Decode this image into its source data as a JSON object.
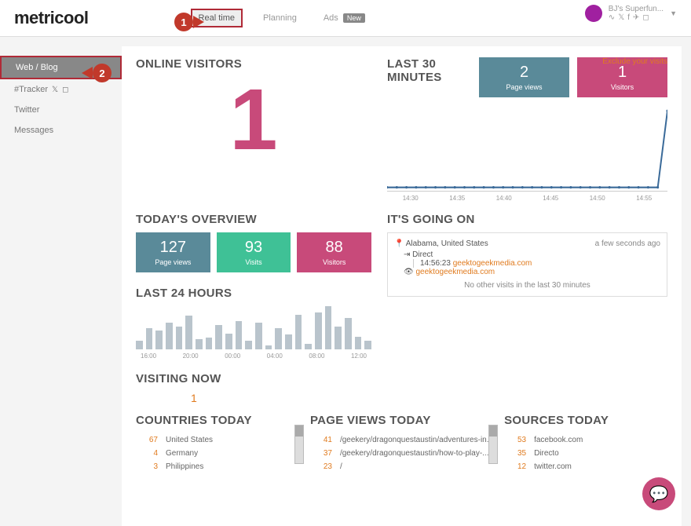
{
  "brand": "metricool",
  "nav": {
    "realtime": "Real time",
    "planning": "Planning",
    "ads": "Ads",
    "ads_badge": "New"
  },
  "user": {
    "name": "BJ's Superfun..."
  },
  "sidebar": {
    "items": [
      {
        "label": "Web / Blog"
      },
      {
        "label": "#Tracker"
      },
      {
        "label": "Twitter"
      },
      {
        "label": "Messages"
      }
    ]
  },
  "exclude_link": "Exclude your visits",
  "online_visitors": {
    "title": "ONLINE VISITORS",
    "value": "1"
  },
  "last30": {
    "title": "LAST 30 MINUTES",
    "pageviews": {
      "value": "2",
      "label": "Page views"
    },
    "visitors": {
      "value": "1",
      "label": "Visitors"
    },
    "x_ticks": [
      "14:30",
      "14:35",
      "14:40",
      "14:45",
      "14:50",
      "14:55"
    ],
    "data": [
      0,
      0,
      0,
      0,
      0,
      0,
      0,
      0,
      0,
      0,
      0,
      0,
      0,
      0,
      0,
      0,
      0,
      0,
      0,
      0,
      0,
      0,
      0,
      0,
      0,
      0,
      0,
      0,
      0,
      2
    ]
  },
  "today_overview": {
    "title": "TODAY'S OVERVIEW",
    "pageviews": {
      "value": "127",
      "label": "Page views"
    },
    "visits": {
      "value": "93",
      "label": "Visits"
    },
    "visitors": {
      "value": "88",
      "label": "Visitors"
    }
  },
  "going": {
    "title": "IT'S GOING ON",
    "location": "Alabama, United States",
    "ago": "a few seconds ago",
    "source": "Direct",
    "time": "14:56:23",
    "link1": "geektogeekmedia.com",
    "link2": "geektogeekmedia.com",
    "none": "No other visits in the last 30 minutes"
  },
  "last24": {
    "title": "LAST 24 HOURS",
    "bars": [
      8,
      20,
      18,
      25,
      22,
      32,
      10,
      11,
      23,
      15,
      27,
      8,
      25,
      4,
      20,
      14,
      33,
      5,
      35,
      41,
      22,
      30,
      12,
      8
    ],
    "x_ticks": [
      "16:00",
      "20:00",
      "00:00",
      "04:00",
      "08:00",
      "12:00"
    ]
  },
  "visiting_now": {
    "title": "VISITING NOW",
    "value": "1"
  },
  "countries": {
    "title": "COUNTRIES TODAY",
    "items": [
      {
        "n": "67",
        "t": "United States"
      },
      {
        "n": "4",
        "t": "Germany"
      },
      {
        "n": "3",
        "t": "Philippines"
      }
    ]
  },
  "pageviews_today": {
    "title": "PAGE VIEWS TODAY",
    "items": [
      {
        "n": "41",
        "t": "/geekery/dragonquestaustin/adventures-in..."
      },
      {
        "n": "37",
        "t": "/geekery/dragonquestaustin/how-to-play-..."
      },
      {
        "n": "23",
        "t": "/"
      }
    ]
  },
  "sources": {
    "title": "SOURCES TODAY",
    "items": [
      {
        "n": "53",
        "t": "facebook.com"
      },
      {
        "n": "35",
        "t": "Directo"
      },
      {
        "n": "12",
        "t": "twitter.com"
      }
    ]
  },
  "callouts": {
    "one": "1",
    "two": "2"
  },
  "chart_data": [
    {
      "type": "line",
      "title": "LAST 30 MINUTES",
      "x": [
        "14:30",
        "14:35",
        "14:40",
        "14:45",
        "14:50",
        "14:55"
      ],
      "series": [
        {
          "name": "visits",
          "values": [
            0,
            0,
            0,
            0,
            0,
            0,
            0,
            0,
            0,
            0,
            0,
            0,
            0,
            0,
            0,
            0,
            0,
            0,
            0,
            0,
            0,
            0,
            0,
            0,
            0,
            0,
            0,
            0,
            0,
            2
          ]
        }
      ],
      "ylim": [
        0,
        2
      ]
    },
    {
      "type": "bar",
      "title": "LAST 24 HOURS",
      "categories": [
        "16:00",
        "20:00",
        "00:00",
        "04:00",
        "08:00",
        "12:00"
      ],
      "values": [
        8,
        20,
        18,
        25,
        22,
        32,
        10,
        11,
        23,
        15,
        27,
        8,
        25,
        4,
        20,
        14,
        33,
        5,
        35,
        41,
        22,
        30,
        12,
        8
      ],
      "ylim": [
        0,
        45
      ]
    }
  ]
}
